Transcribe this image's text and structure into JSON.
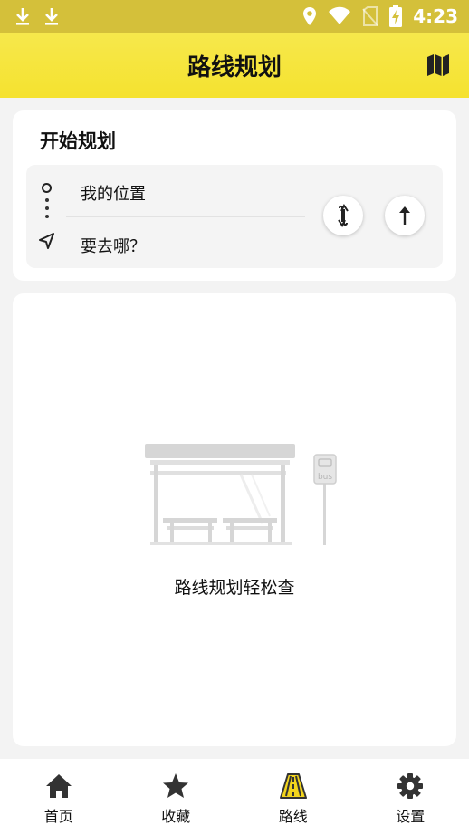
{
  "status_bar": {
    "time": "4:23",
    "icons": [
      "download-icon",
      "download-icon",
      "location-pin-icon",
      "wifi-icon",
      "no-sim-icon",
      "battery-charging-icon"
    ]
  },
  "app_bar": {
    "title": "路线规划",
    "action_icon": "map-icon"
  },
  "plan": {
    "heading": "开始规划",
    "origin_label": "我的位置",
    "destination_placeholder": "要去哪？",
    "swap_icon": "swap-icon",
    "go_icon": "arrow-up-icon"
  },
  "empty_state": {
    "message": "路线规划轻松查",
    "illustration_sign_text": "bus"
  },
  "bottom_nav": {
    "items": [
      {
        "label": "首页",
        "icon": "home-icon",
        "active": false
      },
      {
        "label": "收藏",
        "icon": "star-icon",
        "active": false
      },
      {
        "label": "路线",
        "icon": "road-icon",
        "active": true
      },
      {
        "label": "设置",
        "icon": "gear-icon",
        "active": false
      }
    ]
  },
  "colors": {
    "accent": "#f5e22f",
    "status_bar": "#d4c03a",
    "background": "#f3f3f3"
  }
}
